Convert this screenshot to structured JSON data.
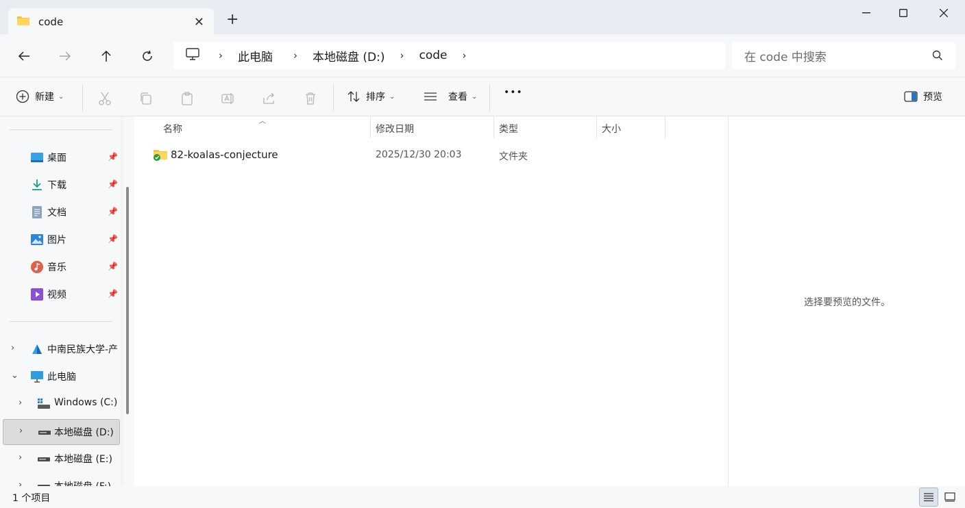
{
  "window": {
    "tab_title": "code",
    "new_tab_label": "+",
    "minimize_label": "—",
    "close_label": "✕"
  },
  "address": {
    "crumbs": [
      "此电脑",
      "本地磁盘 (D:)",
      "code"
    ],
    "separator": "›",
    "search_placeholder": "在 code 中搜索"
  },
  "toolbar": {
    "new_label": "新建",
    "sort_label": "排序",
    "view_label": "查看",
    "more_label": "•••",
    "preview_label": "预览"
  },
  "sidebar": {
    "quick_access": [
      {
        "label": "桌面",
        "icon": "desktop-icon"
      },
      {
        "label": "下载",
        "icon": "download-icon"
      },
      {
        "label": "文档",
        "icon": "document-icon"
      },
      {
        "label": "图片",
        "icon": "pictures-icon"
      },
      {
        "label": "音乐",
        "icon": "music-icon"
      },
      {
        "label": "视频",
        "icon": "video-icon"
      }
    ],
    "cloud": "中南民族大学-产",
    "this_pc": "此电脑",
    "drives": [
      "Windows (C:)",
      "本地磁盘 (D:)",
      "本地磁盘 (E:)",
      "本地磁盘 (F:)"
    ],
    "selected_drive": "本地磁盘 (D:)"
  },
  "columns": {
    "name": "名称",
    "modified": "修改日期",
    "type": "类型",
    "size": "大小"
  },
  "files": [
    {
      "name": "82-koalas-conjecture",
      "modified": "2025/12/30 20:03",
      "type": "文件夹",
      "size": ""
    }
  ],
  "preview": {
    "message": "选择要预览的文件。"
  },
  "status": {
    "item_count": "1 个项目"
  },
  "colors": {
    "folder": "#f4c542",
    "accent": "#005fb8",
    "sync_ok": "#2e9b3a"
  }
}
